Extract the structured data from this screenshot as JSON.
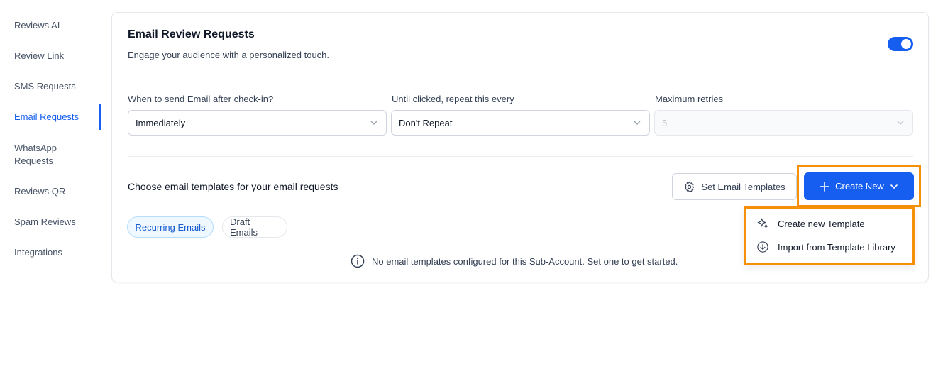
{
  "sidebar": {
    "items": [
      {
        "label": "Reviews AI"
      },
      {
        "label": "Review Link"
      },
      {
        "label": "SMS Requests"
      },
      {
        "label": "Email Requests",
        "active": true
      },
      {
        "label": "WhatsApp Requests"
      },
      {
        "label": "Reviews QR"
      },
      {
        "label": "Spam Reviews"
      },
      {
        "label": "Integrations"
      }
    ]
  },
  "card": {
    "title": "Email Review Requests",
    "subtitle": "Engage your audience with a personalized touch.",
    "toggle_on": true
  },
  "settings": {
    "send_after": {
      "label": "When to send Email after check-in?",
      "value": "Immediately"
    },
    "repeat": {
      "label": "Until clicked, repeat this every",
      "value": "Don't Repeat"
    },
    "max_retries": {
      "label": "Maximum retries",
      "value": "5",
      "disabled": true
    }
  },
  "templates": {
    "title": "Choose email templates for your email requests",
    "set_button": "Set Email Templates",
    "create_button": "Create New",
    "tabs": [
      {
        "label": "Recurring Emails",
        "active": true
      },
      {
        "label": "Draft Emails",
        "active": false
      }
    ],
    "empty_message": "No email templates configured for this Sub-Account. Set one to get started."
  },
  "create_menu": {
    "items": [
      {
        "label": "Create new Template",
        "icon": "sparkle-icon"
      },
      {
        "label": "Import from Template Library",
        "icon": "download-circle-icon"
      }
    ]
  },
  "colors": {
    "accent": "#155eef",
    "highlight": "#f79009"
  }
}
